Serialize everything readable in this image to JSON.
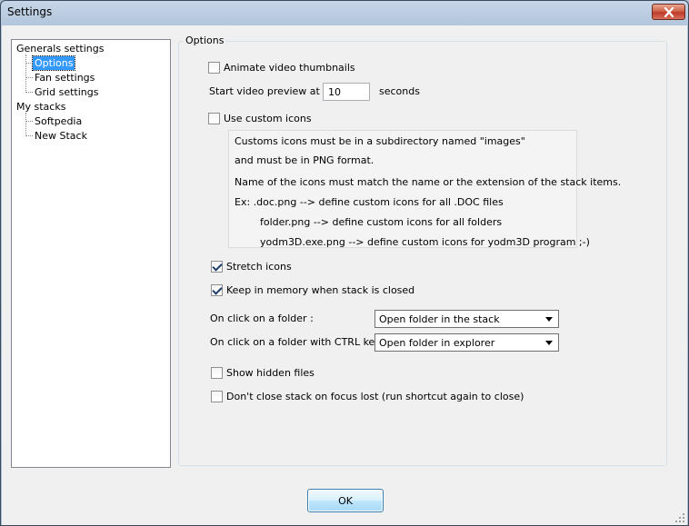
{
  "window": {
    "title": "Settings",
    "close_label": "close"
  },
  "tree": {
    "items": [
      {
        "label": "Generals settings",
        "level": 0
      },
      {
        "label": "Options",
        "level": 1,
        "selected": true
      },
      {
        "label": "Fan settings",
        "level": 1
      },
      {
        "label": "Grid settings",
        "level": 1
      },
      {
        "label": "My stacks",
        "level": 0
      },
      {
        "label": "Softpedia",
        "level": 1
      },
      {
        "label": "New Stack",
        "level": 1
      }
    ]
  },
  "options": {
    "group_title": "Options",
    "animate_thumbnails": {
      "label": "Animate video thumbnails",
      "checked": false
    },
    "preview_delay": {
      "label": "Start video preview at",
      "value": "10",
      "unit": "seconds"
    },
    "custom_icons": {
      "label": "Use custom icons",
      "checked": false
    },
    "info_lines": [
      "Customs icons must be in a subdirectory named \"images\"",
      "and must be in PNG format.",
      "Name of the icons must match the name or the extension of the stack items.",
      "Ex:   .doc.png       -->  define custom icons for all .DOC files",
      "folder.png     -->  define custom icons for all folders",
      "yodm3D.exe.png     -->  define custom icons for yodm3D program  ;-)"
    ],
    "stretch_icons": {
      "label": "Stretch icons",
      "checked": true
    },
    "keep_in_memory": {
      "label": "Keep in memory when stack is closed",
      "checked": true
    },
    "click_folder": {
      "label": "On click on a folder :",
      "value": "Open folder in the stack"
    },
    "click_folder_ctrl": {
      "label": "On click on a folder with CTRL key:",
      "value": "Open folder in explorer"
    },
    "show_hidden": {
      "label": "Show hidden files",
      "checked": false
    },
    "dont_close": {
      "label": "Don't close stack on focus lost  (run shortcut again to close)",
      "checked": false
    }
  },
  "buttons": {
    "ok_label": "OK"
  },
  "colors": {
    "selection": "#3399ff",
    "close_button": "#c0392b"
  }
}
